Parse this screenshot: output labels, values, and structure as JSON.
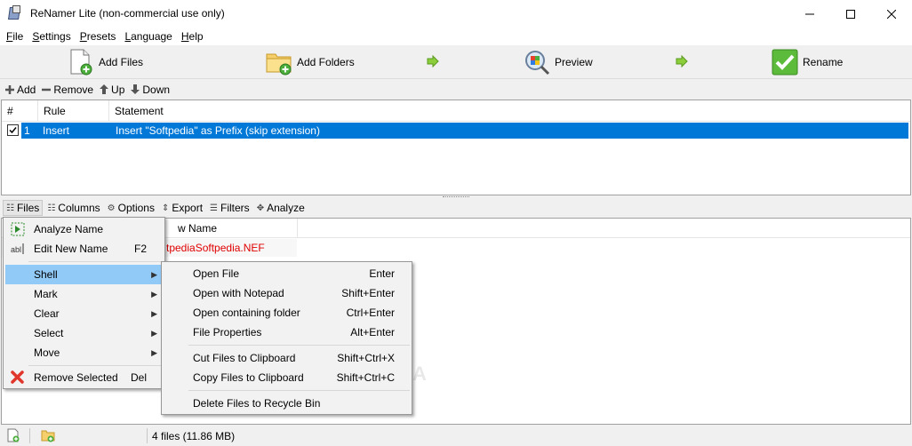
{
  "window": {
    "title": "ReNamer Lite (non-commercial use only)"
  },
  "menu": {
    "items": [
      "File",
      "Settings",
      "Presets",
      "Language",
      "Help"
    ],
    "underlines": [
      "F",
      "S",
      "P",
      "L",
      "H"
    ]
  },
  "toolbar": {
    "add_files": "Add Files",
    "add_folders": "Add Folders",
    "preview": "Preview",
    "rename": "Rename"
  },
  "rules_toolbar": {
    "add": "Add",
    "remove": "Remove",
    "up": "Up",
    "down": "Down"
  },
  "rules_table": {
    "headers": [
      "#",
      "Rule",
      "Statement"
    ],
    "rows": [
      {
        "num": "1",
        "rule": "Insert",
        "statement": "Insert \"Softpedia\" as Prefix (skip extension)",
        "checked": true
      }
    ]
  },
  "files_tabs": [
    "Files",
    "Columns",
    "Options",
    "Export",
    "Filters",
    "Analyze"
  ],
  "files_list": {
    "visible_header": "w Name",
    "visible_new_name": "tpediaSoftpedia.NEF"
  },
  "files_menu": {
    "items": [
      {
        "label": "Analyze Name",
        "key": "",
        "submenu": false
      },
      {
        "label": "Edit New Name",
        "key": "F2",
        "submenu": false
      },
      {
        "label": "Shell",
        "key": "",
        "submenu": true,
        "highlighted": true
      },
      {
        "label": "Mark",
        "key": "",
        "submenu": true
      },
      {
        "label": "Clear",
        "key": "",
        "submenu": true
      },
      {
        "label": "Select",
        "key": "",
        "submenu": true
      },
      {
        "label": "Move",
        "key": "",
        "submenu": true
      },
      {
        "label": "Remove Selected",
        "key": "Del",
        "submenu": false
      }
    ]
  },
  "shell_menu": {
    "items": [
      {
        "label": "Open File",
        "key": "Enter"
      },
      {
        "label": "Open with Notepad",
        "key": "Shift+Enter"
      },
      {
        "label": "Open containing folder",
        "key": "Ctrl+Enter"
      },
      {
        "label": "File Properties",
        "key": "Alt+Enter"
      },
      {
        "label": "Cut Files to Clipboard",
        "key": "Shift+Ctrl+X"
      },
      {
        "label": "Copy Files to Clipboard",
        "key": "Shift+Ctrl+C"
      },
      {
        "label": "Delete Files to Recycle Bin",
        "key": ""
      }
    ]
  },
  "status": {
    "summary": "4 files (11.86 MB)"
  },
  "watermark": "SOFTPEDIA",
  "colors": {
    "selection": "#0078d7",
    "menu_highlight": "#91c9f7",
    "new_name": "#e00000"
  }
}
